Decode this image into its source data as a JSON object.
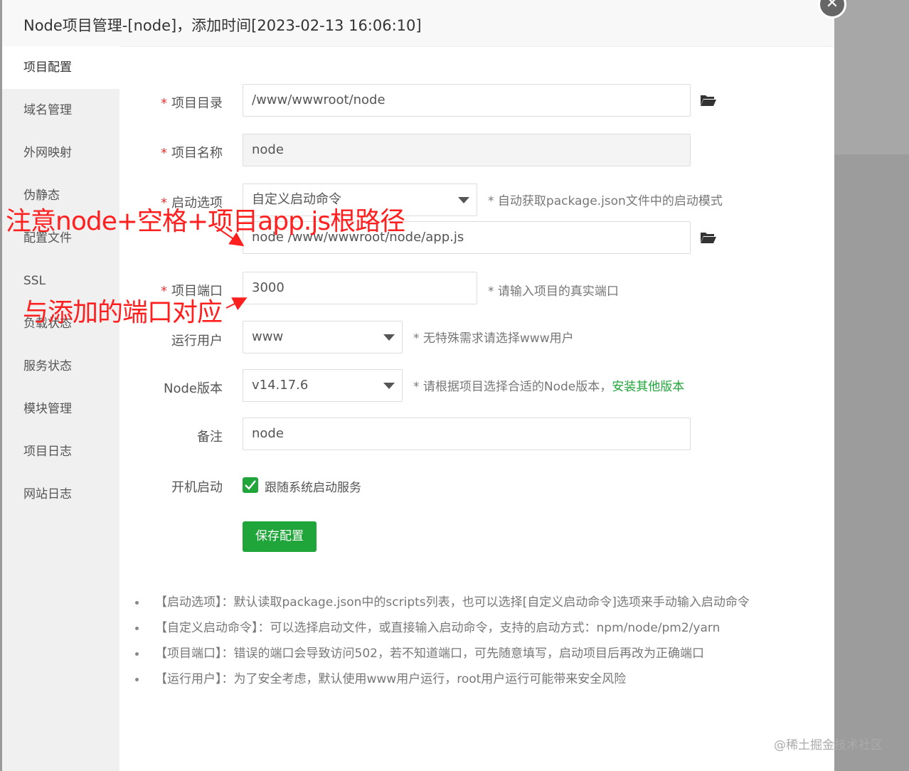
{
  "modal": {
    "title": "Node项目管理-[node]，添加时间[2023-02-13 16:06:10]",
    "close_icon": "close-icon"
  },
  "sidebar": {
    "items": [
      {
        "label": "项目配置",
        "active": true
      },
      {
        "label": "域名管理"
      },
      {
        "label": "外网映射"
      },
      {
        "label": "伪静态"
      },
      {
        "label": "配置文件"
      },
      {
        "label": "SSL"
      },
      {
        "label": "负载状态"
      },
      {
        "label": "服务状态"
      },
      {
        "label": "模块管理"
      },
      {
        "label": "项目日志"
      },
      {
        "label": "网站日志"
      }
    ]
  },
  "form": {
    "required_mark": "*",
    "project_dir": {
      "label": "项目目录",
      "value": "/www/wwwroot/node"
    },
    "project_name": {
      "label": "项目名称",
      "value": "node"
    },
    "start_option": {
      "label": "启动选项",
      "value": "自定义启动命令",
      "hint": "* 自动获取package.json文件中的启动模式"
    },
    "start_command": {
      "value": "node /www/wwwroot/node/app.js"
    },
    "port": {
      "label": "项目端口",
      "value": "3000",
      "hint": "* 请输入项目的真实端口"
    },
    "run_user": {
      "label": "运行用户",
      "value": "www",
      "hint": "* 无特殊需求请选择www用户"
    },
    "node_version": {
      "label": "Node版本",
      "value": "v14.17.6",
      "hint": "* 请根据项目选择合适的Node版本，",
      "link": "安装其他版本"
    },
    "remark": {
      "label": "备注",
      "value": "node"
    },
    "autostart": {
      "label": "开机启动",
      "checkbox_label": "跟随系统启动服务",
      "checked": true
    },
    "save_label": "保存配置"
  },
  "notes": [
    "【启动选项】：默认读取package.json中的scripts列表，也可以选择[自定义启动命令]选项来手动输入启动命令",
    "【自定义启动命令】：可以选择启动文件，或直接输入启动命令，支持的启动方式：npm/node/pm2/yarn",
    "【项目端口】：错误的端口会导致访问502，若不知道端口，可先随意填写，启动项目后再改为正确端口",
    "【运行用户】：为了安全考虑，默认使用www用户运行，root用户运行可能带来安全风险"
  ],
  "annotations": {
    "note1": "注意node+空格+项目app.js根路径",
    "note2": "与添加的端口对应"
  },
  "watermark": "@稀土掘金技术社区",
  "colors": {
    "accent": "#20a53a",
    "annotation": "#ff1f1f",
    "required": "#e33333"
  }
}
